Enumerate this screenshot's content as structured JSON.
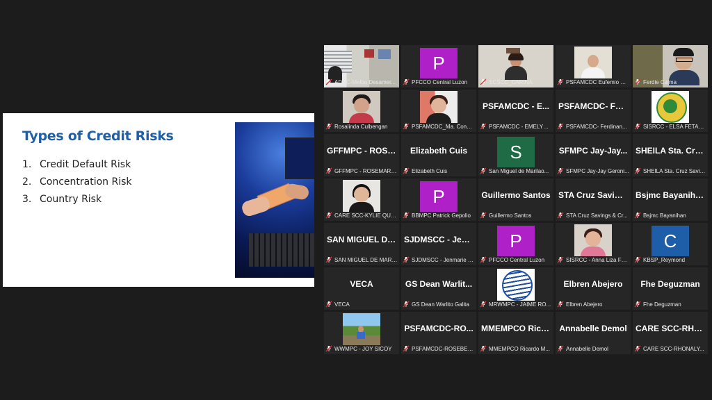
{
  "slide": {
    "title": "Types of Credit Risks",
    "items": [
      {
        "num": "1.",
        "text": "Credit Default Risk"
      },
      {
        "num": "2.",
        "text": "Concentration Risk"
      },
      {
        "num": "3.",
        "text": "Country Risk"
      }
    ]
  },
  "gallery": {
    "colors": {
      "avatar_purple": "#b020c8",
      "avatar_green": "#1e6b46",
      "avatar_blue": "#1e5ea8",
      "active_border": "#cfe055",
      "muted_mic": "#e03030"
    },
    "tiles": [
      {
        "label": "ADCC-Melba Desamer...",
        "kind": "photo",
        "photo": "office"
      },
      {
        "label": "PFCCO Central Luzon",
        "kind": "letter",
        "letter": "P",
        "avatar_color": "purple"
      },
      {
        "label": "SCSCC_CARINA",
        "kind": "photo",
        "photo": "woman-room"
      },
      {
        "label": "PSFAMCDC Eufemio G...",
        "kind": "photo",
        "photo": "man-room"
      },
      {
        "label": "Ferdie Calma",
        "kind": "photo",
        "photo": "man-glasses",
        "active": true
      },
      {
        "label": "Rosalinda Culbengan",
        "kind": "photo",
        "photo": "woman-glasses"
      },
      {
        "label": "PSFAMCDC_Ma. Conce...",
        "kind": "photo",
        "photo": "woman-red"
      },
      {
        "label": "PSFAMCDC - EMELYN ...",
        "kind": "name",
        "display_name": "PSFAMCDC - E..."
      },
      {
        "label": "PSFAMCDC- Ferdinan...",
        "kind": "name",
        "display_name": "PSFAMCDC- Fer..."
      },
      {
        "label": "SISRCC - ELSA FETALC...",
        "kind": "photo",
        "photo": "seal"
      },
      {
        "label": "GFFMPC - ROSEMARIE...",
        "kind": "name",
        "display_name": "GFFMPC - ROSE..."
      },
      {
        "label": "Elizabeth Cuis",
        "kind": "name",
        "display_name": "Elizabeth Cuis"
      },
      {
        "label": "San Miguel de Marilao...",
        "kind": "letter",
        "letter": "S",
        "avatar_color": "green"
      },
      {
        "label": "SFMPC Jay-Jay Geroni...",
        "kind": "name",
        "display_name": "SFMPC Jay-Jay..."
      },
      {
        "label": "SHEILA Sta. Cruz Savin...",
        "kind": "name",
        "display_name": "SHEILA Sta. Cru..."
      },
      {
        "label": "CARE SCC-KYLIE QUE...",
        "kind": "photo",
        "photo": "woman-portrait"
      },
      {
        "label": "BBMPC Patrick Gepolio",
        "kind": "letter",
        "letter": "P",
        "avatar_color": "purple"
      },
      {
        "label": "Guillermo Santos",
        "kind": "name",
        "display_name": "Guillermo Santos"
      },
      {
        "label": "STA Cruz Savings & Cr...",
        "kind": "name",
        "display_name": "STA Cruz Saving..."
      },
      {
        "label": "Bsjmc Bayanihan",
        "kind": "name",
        "display_name": "Bsjmc Bayanihan"
      },
      {
        "label": "SAN MIGUEL DE MARI...",
        "kind": "name",
        "display_name": "SAN MIGUEL DE..."
      },
      {
        "label": "SJDMSCC - Jenmarie E...",
        "kind": "name",
        "display_name": "SJDMSCC - Jen..."
      },
      {
        "label": "PFCCO Central Luzon",
        "kind": "letter",
        "letter": "P",
        "avatar_color": "purple"
      },
      {
        "label": "SISRCC - Anna Liza Fer...",
        "kind": "photo",
        "photo": "woman-pink"
      },
      {
        "label": "KBSP_Reymond",
        "kind": "letter",
        "letter": "C",
        "avatar_color": "blue"
      },
      {
        "label": "VECA",
        "kind": "name",
        "display_name": "VECA"
      },
      {
        "label": "GS Dean Warlito Galita",
        "kind": "name",
        "display_name": "GS Dean Warlit..."
      },
      {
        "label": "MRWMPC - JAIME RO...",
        "kind": "photo",
        "photo": "logo-wave"
      },
      {
        "label": "Elbren Abejero",
        "kind": "name",
        "display_name": "Elbren Abejero"
      },
      {
        "label": "Fhe Deguzman",
        "kind": "name",
        "display_name": "Fhe Deguzman"
      },
      {
        "label": "WWMPC - JOY SICOY",
        "kind": "photo",
        "photo": "outdoor"
      },
      {
        "label": "PSFAMCDC-ROSEBEL ...",
        "kind": "name",
        "display_name": "PSFAMCDC-RO..."
      },
      {
        "label": "MMEMPCO Ricardo M...",
        "kind": "name",
        "display_name": "MMEMPCO Rica..."
      },
      {
        "label": "Annabelle Demol",
        "kind": "name",
        "display_name": "Annabelle Demol"
      },
      {
        "label": "CARE SCC-RHONALY...",
        "kind": "name",
        "display_name": "CARE SCC-RHO..."
      }
    ]
  }
}
